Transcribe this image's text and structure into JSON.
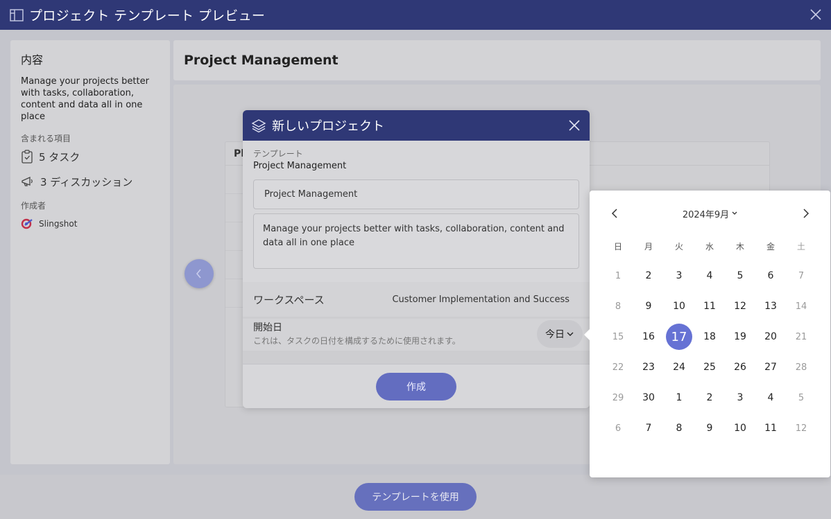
{
  "window": {
    "title": "プロジェクト テンプレート プレビュー"
  },
  "left_panel": {
    "heading": "内容",
    "description": "Manage your projects better with tasks, collaboration, content and data all in one place",
    "included_label": "含まれる項目",
    "tasks": "5 タスク",
    "discussions": "3 ディスカッション",
    "author_label": "作成者",
    "author": "Slingshot"
  },
  "project": {
    "title": "Project Management",
    "preview_col": "Pl"
  },
  "footer": {
    "use_template": "テンプレートを使用"
  },
  "dialog": {
    "title": "新しいプロジェクト",
    "template_label": "テンプレート",
    "template_value": "Project Management",
    "name_value": "Project Management",
    "description_value": "Manage your projects better with tasks, collaboration, content and data all in one place",
    "workspace_label": "ワークスペース",
    "workspace_value": "Customer Implementation and Success",
    "start_label": "開始日",
    "start_help": "これは、タスクの日付を構成するために使用されます。",
    "today": "今日",
    "create": "作成"
  },
  "calendar": {
    "month_label": "2024年9月",
    "weekdays": [
      "日",
      "月",
      "火",
      "水",
      "木",
      "金",
      "土"
    ],
    "weeks": [
      [
        "1",
        "2",
        "3",
        "4",
        "5",
        "6",
        "7"
      ],
      [
        "8",
        "9",
        "10",
        "11",
        "12",
        "13",
        "14"
      ],
      [
        "15",
        "16",
        "17",
        "18",
        "19",
        "20",
        "21"
      ],
      [
        "22",
        "23",
        "24",
        "25",
        "26",
        "27",
        "28"
      ],
      [
        "29",
        "30",
        "1",
        "2",
        "3",
        "4",
        "5"
      ],
      [
        "6",
        "7",
        "8",
        "9",
        "10",
        "11",
        "12"
      ]
    ],
    "selected": "17",
    "accent": "#6672d4"
  },
  "colors": {
    "header": "#2f3876",
    "button": "#6670bd"
  }
}
